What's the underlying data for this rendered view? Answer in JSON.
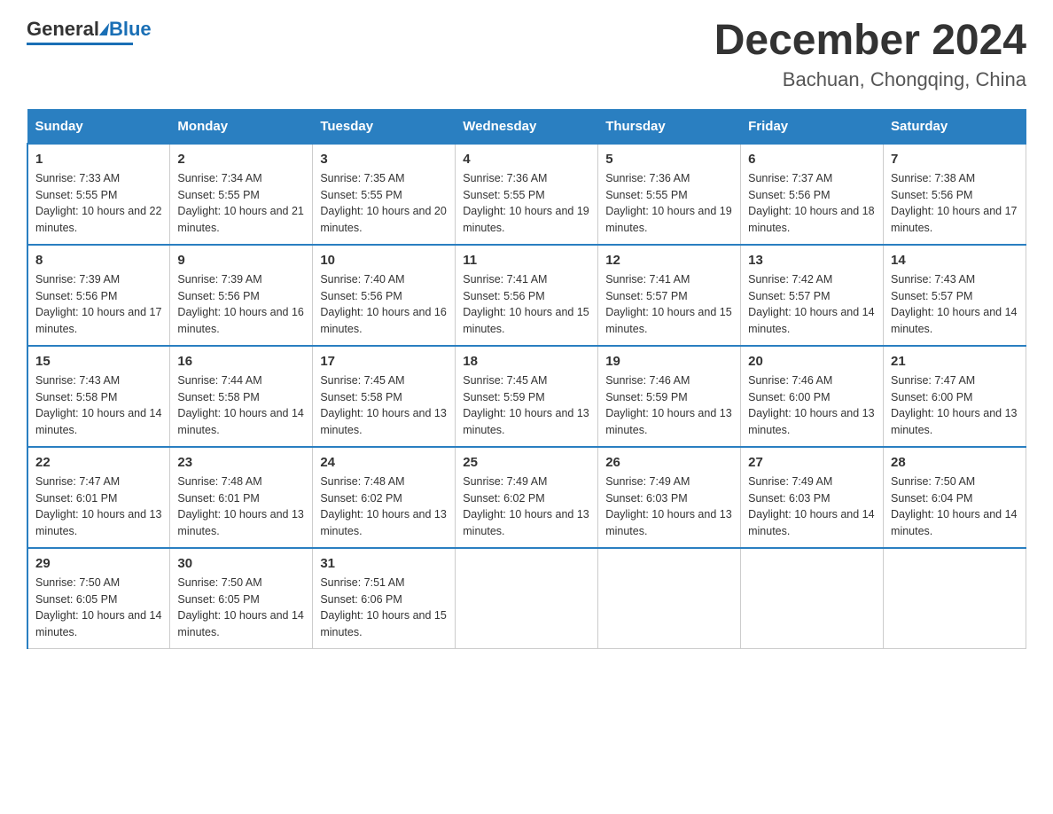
{
  "header": {
    "logo_general": "General",
    "logo_blue": "Blue",
    "month_title": "December 2024",
    "location": "Bachuan, Chongqing, China"
  },
  "days_of_week": [
    "Sunday",
    "Monday",
    "Tuesday",
    "Wednesday",
    "Thursday",
    "Friday",
    "Saturday"
  ],
  "weeks": [
    [
      {
        "day": 1,
        "sunrise": "7:33 AM",
        "sunset": "5:55 PM",
        "daylight": "10 hours and 22 minutes."
      },
      {
        "day": 2,
        "sunrise": "7:34 AM",
        "sunset": "5:55 PM",
        "daylight": "10 hours and 21 minutes."
      },
      {
        "day": 3,
        "sunrise": "7:35 AM",
        "sunset": "5:55 PM",
        "daylight": "10 hours and 20 minutes."
      },
      {
        "day": 4,
        "sunrise": "7:36 AM",
        "sunset": "5:55 PM",
        "daylight": "10 hours and 19 minutes."
      },
      {
        "day": 5,
        "sunrise": "7:36 AM",
        "sunset": "5:55 PM",
        "daylight": "10 hours and 19 minutes."
      },
      {
        "day": 6,
        "sunrise": "7:37 AM",
        "sunset": "5:56 PM",
        "daylight": "10 hours and 18 minutes."
      },
      {
        "day": 7,
        "sunrise": "7:38 AM",
        "sunset": "5:56 PM",
        "daylight": "10 hours and 17 minutes."
      }
    ],
    [
      {
        "day": 8,
        "sunrise": "7:39 AM",
        "sunset": "5:56 PM",
        "daylight": "10 hours and 17 minutes."
      },
      {
        "day": 9,
        "sunrise": "7:39 AM",
        "sunset": "5:56 PM",
        "daylight": "10 hours and 16 minutes."
      },
      {
        "day": 10,
        "sunrise": "7:40 AM",
        "sunset": "5:56 PM",
        "daylight": "10 hours and 16 minutes."
      },
      {
        "day": 11,
        "sunrise": "7:41 AM",
        "sunset": "5:56 PM",
        "daylight": "10 hours and 15 minutes."
      },
      {
        "day": 12,
        "sunrise": "7:41 AM",
        "sunset": "5:57 PM",
        "daylight": "10 hours and 15 minutes."
      },
      {
        "day": 13,
        "sunrise": "7:42 AM",
        "sunset": "5:57 PM",
        "daylight": "10 hours and 14 minutes."
      },
      {
        "day": 14,
        "sunrise": "7:43 AM",
        "sunset": "5:57 PM",
        "daylight": "10 hours and 14 minutes."
      }
    ],
    [
      {
        "day": 15,
        "sunrise": "7:43 AM",
        "sunset": "5:58 PM",
        "daylight": "10 hours and 14 minutes."
      },
      {
        "day": 16,
        "sunrise": "7:44 AM",
        "sunset": "5:58 PM",
        "daylight": "10 hours and 14 minutes."
      },
      {
        "day": 17,
        "sunrise": "7:45 AM",
        "sunset": "5:58 PM",
        "daylight": "10 hours and 13 minutes."
      },
      {
        "day": 18,
        "sunrise": "7:45 AM",
        "sunset": "5:59 PM",
        "daylight": "10 hours and 13 minutes."
      },
      {
        "day": 19,
        "sunrise": "7:46 AM",
        "sunset": "5:59 PM",
        "daylight": "10 hours and 13 minutes."
      },
      {
        "day": 20,
        "sunrise": "7:46 AM",
        "sunset": "6:00 PM",
        "daylight": "10 hours and 13 minutes."
      },
      {
        "day": 21,
        "sunrise": "7:47 AM",
        "sunset": "6:00 PM",
        "daylight": "10 hours and 13 minutes."
      }
    ],
    [
      {
        "day": 22,
        "sunrise": "7:47 AM",
        "sunset": "6:01 PM",
        "daylight": "10 hours and 13 minutes."
      },
      {
        "day": 23,
        "sunrise": "7:48 AM",
        "sunset": "6:01 PM",
        "daylight": "10 hours and 13 minutes."
      },
      {
        "day": 24,
        "sunrise": "7:48 AM",
        "sunset": "6:02 PM",
        "daylight": "10 hours and 13 minutes."
      },
      {
        "day": 25,
        "sunrise": "7:49 AM",
        "sunset": "6:02 PM",
        "daylight": "10 hours and 13 minutes."
      },
      {
        "day": 26,
        "sunrise": "7:49 AM",
        "sunset": "6:03 PM",
        "daylight": "10 hours and 13 minutes."
      },
      {
        "day": 27,
        "sunrise": "7:49 AM",
        "sunset": "6:03 PM",
        "daylight": "10 hours and 14 minutes."
      },
      {
        "day": 28,
        "sunrise": "7:50 AM",
        "sunset": "6:04 PM",
        "daylight": "10 hours and 14 minutes."
      }
    ],
    [
      {
        "day": 29,
        "sunrise": "7:50 AM",
        "sunset": "6:05 PM",
        "daylight": "10 hours and 14 minutes."
      },
      {
        "day": 30,
        "sunrise": "7:50 AM",
        "sunset": "6:05 PM",
        "daylight": "10 hours and 14 minutes."
      },
      {
        "day": 31,
        "sunrise": "7:51 AM",
        "sunset": "6:06 PM",
        "daylight": "10 hours and 15 minutes."
      },
      null,
      null,
      null,
      null
    ]
  ]
}
